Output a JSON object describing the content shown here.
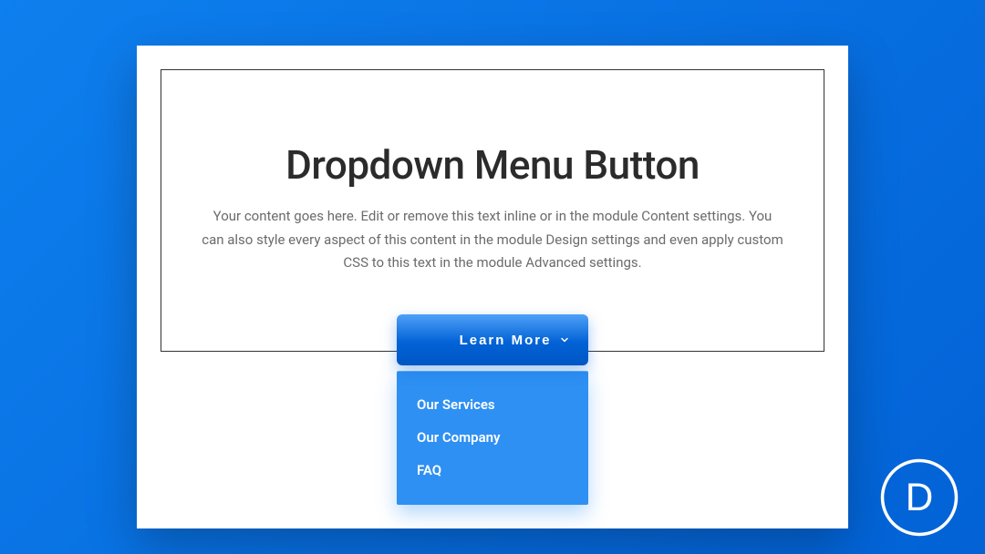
{
  "header": {
    "title": "Dropdown Menu Button",
    "description": "Your content goes here. Edit or remove this text inline or in the module Content settings. You can also style every aspect of this content in the module Design settings and even apply custom CSS to this text in the module Advanced settings."
  },
  "dropdown": {
    "button_label": "Learn More",
    "items": [
      {
        "label": "Our Services"
      },
      {
        "label": "Our Company"
      },
      {
        "label": "FAQ"
      }
    ]
  },
  "brand": {
    "letter": "D"
  }
}
